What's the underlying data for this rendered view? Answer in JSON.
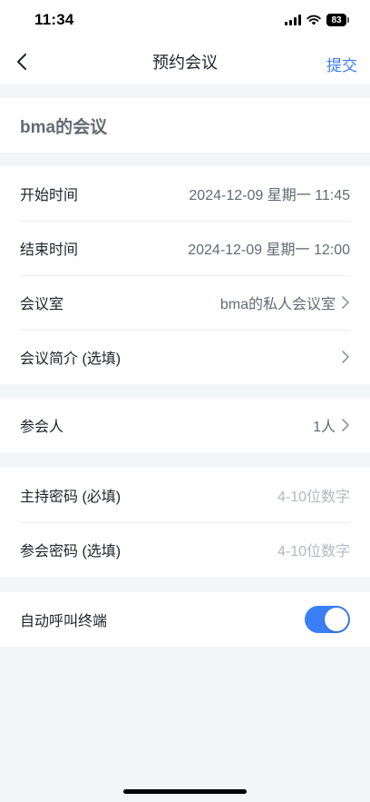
{
  "status_bar": {
    "time": "11:34",
    "battery": "83"
  },
  "nav": {
    "title": "预约会议",
    "submit": "提交"
  },
  "meeting": {
    "title": "bma的会议"
  },
  "time_rows": [
    {
      "label": "开始时间",
      "value": "2024-12-09 星期一 11:45"
    },
    {
      "label": "结束时间",
      "value": "2024-12-09 星期一 12:00"
    },
    {
      "label": "会议室",
      "value": "bma的私人会议室"
    },
    {
      "label": "会议简介 (选填)",
      "value": ""
    }
  ],
  "participants": {
    "label": "参会人",
    "value": "1人"
  },
  "passwords": [
    {
      "label": "主持密码 (必填)",
      "placeholder": "4-10位数字"
    },
    {
      "label": "参会密码 (选填)",
      "placeholder": "4-10位数字"
    }
  ],
  "auto_call": {
    "label": "自动呼叫终端",
    "enabled": true
  },
  "colors": {
    "accent": "#3a7ff6",
    "background": "#f4f5f7",
    "placeholder": "#b4b8bf"
  },
  "icons": [
    "back-chevron-icon",
    "chevron-right-icon",
    "cellular-signal-icon",
    "wifi-icon",
    "battery-icon"
  ]
}
